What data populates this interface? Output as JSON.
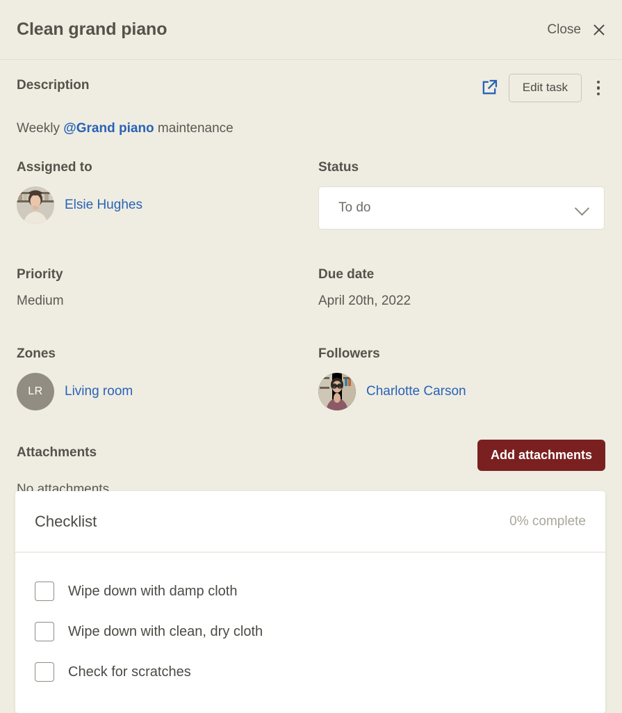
{
  "header": {
    "title": "Clean grand piano",
    "close_label": "Close",
    "close_icon": "close-x-icon"
  },
  "description": {
    "label": "Description",
    "text_before": "Weekly ",
    "mention": "@Grand piano",
    "text_after": " maintenance",
    "external_link_icon": "external-link-icon",
    "edit_button": "Edit task",
    "more_icon": "kebab-menu-icon"
  },
  "fields": {
    "assigned_to": {
      "label": "Assigned to",
      "person": "Elsie Hughes"
    },
    "status": {
      "label": "Status",
      "value": "To do",
      "chevron_icon": "chevron-down-icon"
    },
    "priority": {
      "label": "Priority",
      "value": "Medium"
    },
    "due_date": {
      "label": "Due date",
      "value": "April 20th, 2022"
    },
    "zones": {
      "label": "Zones",
      "initials": "LR",
      "value": "Living room"
    },
    "followers": {
      "label": "Followers",
      "person": "Charlotte Carson"
    }
  },
  "attachments": {
    "label": "Attachments",
    "empty_text": "No attachments",
    "add_button": "Add attachments"
  },
  "checklist": {
    "title": "Checklist",
    "progress": "0% complete",
    "items": [
      {
        "label": "Wipe down with damp cloth",
        "checked": false
      },
      {
        "label": "Wipe down with clean, dry cloth",
        "checked": false
      },
      {
        "label": "Check for scratches",
        "checked": false
      }
    ]
  },
  "colors": {
    "background": "#EFEDE2",
    "link": "#2A62B6",
    "primary_button": "#7B2020",
    "card": "#FFFFFF",
    "avatar_placeholder": "#928D82"
  }
}
